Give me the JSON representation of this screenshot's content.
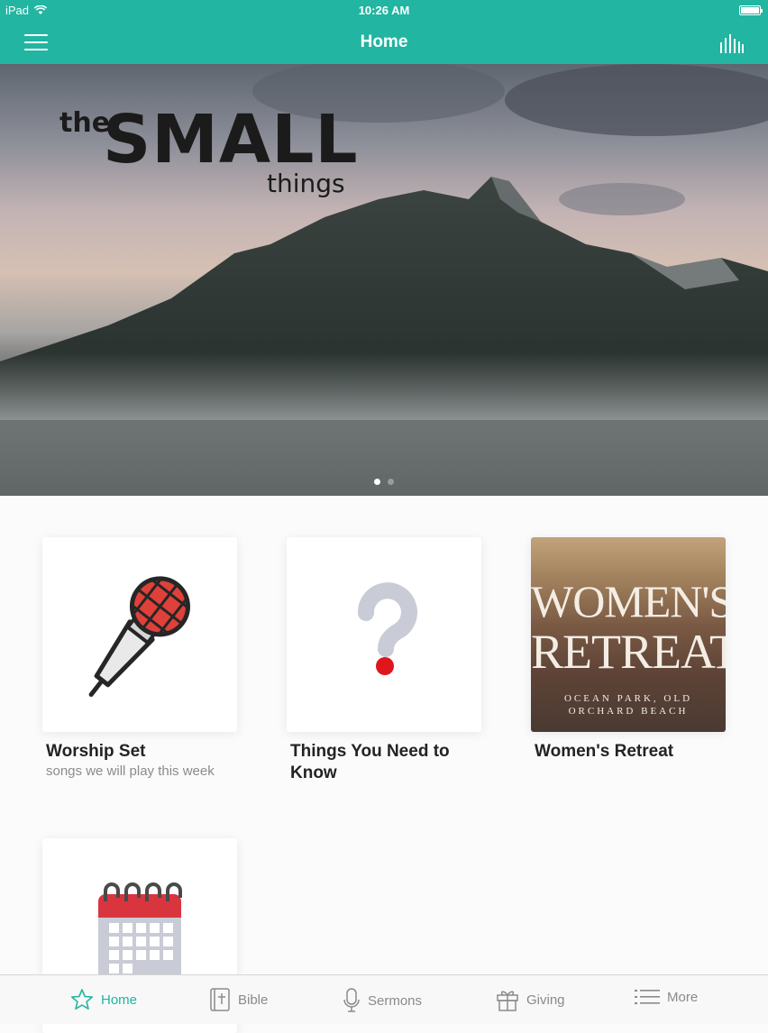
{
  "status_bar": {
    "carrier": "iPad",
    "time": "10:26 AM"
  },
  "nav": {
    "title": "Home"
  },
  "hero": {
    "logo_the": "the",
    "logo_small": "SMALL",
    "logo_things": "things",
    "slides_count": 2,
    "active_slide": 1
  },
  "cards": [
    {
      "title": "Worship Set",
      "subtitle": "songs we will play this week",
      "icon": "microphone-icon"
    },
    {
      "title": "Things You Need to Know",
      "subtitle": "",
      "icon": "question-mark-icon"
    },
    {
      "title": "Women's Retreat",
      "subtitle": "",
      "image_line1": "WOMEN'S",
      "image_line2": "RETREAT",
      "image_caption": "OCEAN PARK, OLD ORCHARD BEACH"
    },
    {
      "title": "",
      "subtitle": "",
      "icon": "calendar-icon"
    }
  ],
  "tabs": [
    {
      "label": "Home",
      "icon": "star-icon",
      "active": true
    },
    {
      "label": "Bible",
      "icon": "bible-icon",
      "active": false
    },
    {
      "label": "Sermons",
      "icon": "microphone-icon",
      "active": false
    },
    {
      "label": "Giving",
      "icon": "gift-icon",
      "active": false
    },
    {
      "label": "More",
      "icon": "list-icon",
      "active": false
    }
  ],
  "colors": {
    "accent": "#21b5a2",
    "mic_red": "#e0403a",
    "calendar_red": "#d9353f",
    "question_gray": "#c9ccd6"
  }
}
